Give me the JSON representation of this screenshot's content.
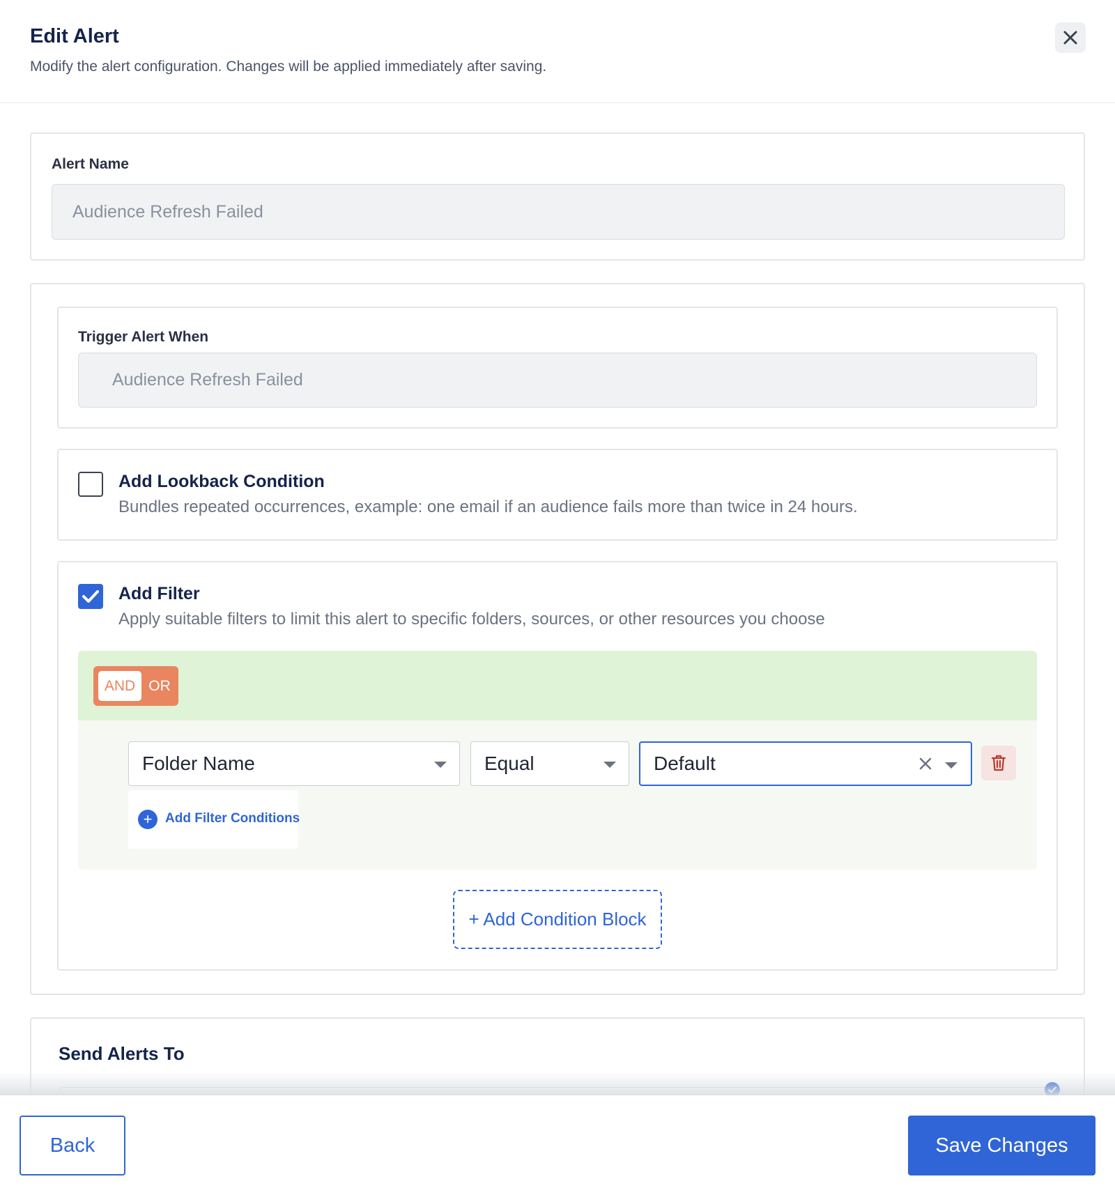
{
  "dialog": {
    "title": "Edit Alert",
    "subtitle": "Modify the alert configuration. Changes will be applied immediately after saving."
  },
  "alert_name": {
    "label": "Alert Name",
    "value": "Audience Refresh Failed"
  },
  "trigger": {
    "label": "Trigger Alert When",
    "value": "Audience Refresh Failed"
  },
  "lookback": {
    "checked": false,
    "title": "Add Lookback Condition",
    "description": "Bundles repeated occurrences, example: one email if an audience fails more than twice in 24 hours."
  },
  "filter": {
    "checked": true,
    "title": "Add Filter",
    "description": "Apply suitable filters to limit this alert to specific folders, sources, or other resources you choose",
    "logic_toggle": {
      "and_label": "AND",
      "or_label": "OR",
      "selected": "AND"
    },
    "condition": {
      "field": "Folder Name",
      "operator": "Equal",
      "value": "Default"
    },
    "add_conditions_label": "Add Filter Conditions",
    "add_block_label": "+ Add Condition Block"
  },
  "send_alerts": {
    "title": "Send Alerts To"
  },
  "footer": {
    "back_label": "Back",
    "save_label": "Save Changes"
  },
  "colors": {
    "primary": "#2f65d6",
    "group_header": "#dff3d6",
    "toggle": "#e9865f",
    "danger": "#c0392b"
  }
}
